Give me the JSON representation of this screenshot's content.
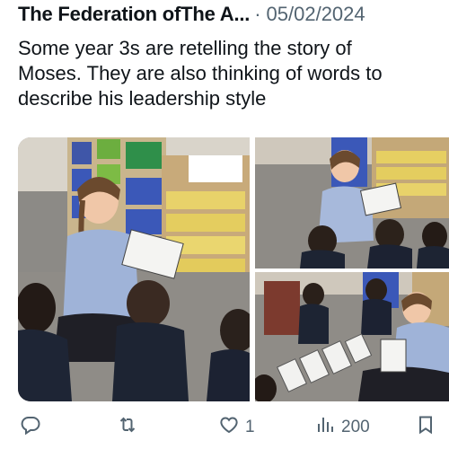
{
  "tweet": {
    "author": "The Federation ofThe A...",
    "separator": "·",
    "date": "05/02/2024",
    "text": "Some year 3s are retelling the story of\nMoses. They are also thinking of words to\ndescribe his leadership style"
  },
  "actions": {
    "reply_count": "",
    "retweet_count": "",
    "like_count": "1",
    "views_count": "200"
  },
  "media": {
    "photos": [
      "photo-1",
      "photo-2",
      "photo-3"
    ]
  },
  "icons": {
    "reply": "reply-icon",
    "retweet": "retweet-icon",
    "like": "heart-icon",
    "views": "views-icon",
    "bookmark": "bookmark-icon"
  }
}
